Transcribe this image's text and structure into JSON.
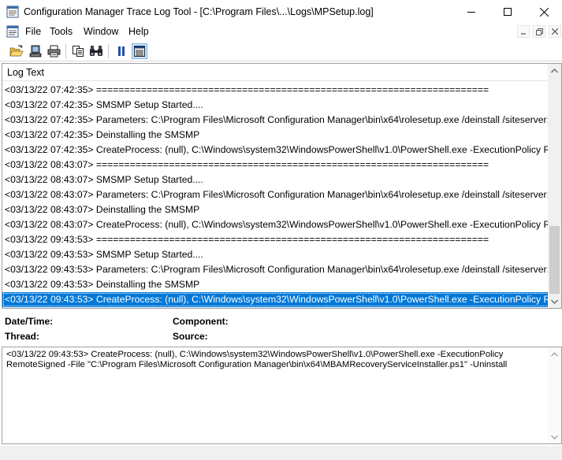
{
  "window": {
    "title": "Configuration Manager Trace Log Tool - [C:\\Program Files\\...\\Logs\\MPSetup.log]"
  },
  "menu": {
    "items": [
      "File",
      "Tools",
      "Window",
      "Help"
    ]
  },
  "toolbar": {
    "buttons": [
      "open-folder-icon",
      "computer-icon",
      "print-icon",
      "copy-icon",
      "find-icon",
      "pause-icon",
      "details-pane-icon"
    ]
  },
  "log": {
    "header": "Log Text",
    "rows": [
      "<03/13/22 07:42:35> ======================================================================",
      "<03/13/22 07:42:35> SMSMP Setup Started....",
      "<03/13/22 07:42:35> Parameters: C:\\Program Files\\Microsoft Configuration Manager\\bin\\x64\\rolesetup.exe /deinstall /siteserver:...",
      "<03/13/22 07:42:35> Deinstalling the SMSMP",
      "<03/13/22 07:42:35> CreateProcess: (null), C:\\Windows\\system32\\WindowsPowerShell\\v1.0\\PowerShell.exe -ExecutionPolicy Re...",
      "<03/13/22 08:43:07> ======================================================================",
      "<03/13/22 08:43:07> SMSMP Setup Started....",
      "<03/13/22 08:43:07> Parameters: C:\\Program Files\\Microsoft Configuration Manager\\bin\\x64\\rolesetup.exe /deinstall /siteserver:...",
      "<03/13/22 08:43:07> Deinstalling the SMSMP",
      "<03/13/22 08:43:07> CreateProcess: (null), C:\\Windows\\system32\\WindowsPowerShell\\v1.0\\PowerShell.exe -ExecutionPolicy Re...",
      "<03/13/22 09:43:53> ======================================================================",
      "<03/13/22 09:43:53> SMSMP Setup Started....",
      "<03/13/22 09:43:53> Parameters: C:\\Program Files\\Microsoft Configuration Manager\\bin\\x64\\rolesetup.exe /deinstall /siteserver:...",
      "<03/13/22 09:43:53> Deinstalling the SMSMP",
      "<03/13/22 09:43:53> CreateProcess: (null), C:\\Windows\\system32\\WindowsPowerShell\\v1.0\\PowerShell.exe -ExecutionPolicy Re..."
    ],
    "selected_index": 14
  },
  "details": {
    "datetime_label": "Date/Time:",
    "component_label": "Component:",
    "thread_label": "Thread:",
    "source_label": "Source:"
  },
  "message": {
    "text": "<03/13/22 09:43:53> CreateProcess: (null), C:\\Windows\\system32\\WindowsPowerShell\\v1.0\\PowerShell.exe -ExecutionPolicy\nRemoteSigned -File \"C:\\Program Files\\Microsoft Configuration Manager\\bin\\x64\\MBAMRecoveryServiceInstaller.ps1\" -Uninstall"
  },
  "colors": {
    "selection": "#0078d7",
    "pause_icon": "#1f4fa8"
  }
}
